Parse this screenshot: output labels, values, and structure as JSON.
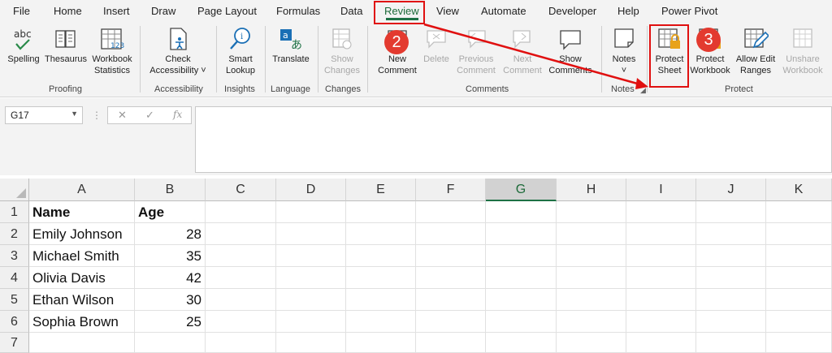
{
  "menu": {
    "tabs": [
      "File",
      "Home",
      "Insert",
      "Draw",
      "Page Layout",
      "Formulas",
      "Data",
      "Review",
      "View",
      "Automate",
      "Developer",
      "Help",
      "Power Pivot"
    ],
    "active_tab": "Review"
  },
  "ribbon": {
    "groups": [
      {
        "label": "Proofing",
        "buttons": [
          {
            "line1": "Spelling",
            "line2": "",
            "icon": "spelling-icon"
          },
          {
            "line1": "Thesaurus",
            "line2": "",
            "icon": "thesaurus-icon"
          },
          {
            "line1": "Workbook",
            "line2": "Statistics",
            "icon": "workbook-statistics-icon"
          }
        ]
      },
      {
        "label": "Accessibility",
        "buttons": [
          {
            "line1": "Check",
            "line2": "Accessibility ˅",
            "icon": "check-accessibility-icon"
          }
        ]
      },
      {
        "label": "Insights",
        "buttons": [
          {
            "line1": "Smart",
            "line2": "Lookup",
            "icon": "smart-lookup-icon"
          }
        ]
      },
      {
        "label": "Language",
        "buttons": [
          {
            "line1": "Translate",
            "line2": "",
            "icon": "translate-icon"
          }
        ]
      },
      {
        "label": "Changes",
        "buttons": [
          {
            "line1": "Show",
            "line2": "Changes",
            "icon": "show-changes-icon",
            "disabled": true
          }
        ]
      },
      {
        "label": "Comments",
        "buttons": [
          {
            "line1": "New",
            "line2": "Comment",
            "icon": "new-comment-icon"
          },
          {
            "line1": "Delete",
            "line2": "",
            "icon": "delete-comment-icon",
            "disabled": true
          },
          {
            "line1": "Previous",
            "line2": "Comment",
            "icon": "previous-comment-icon",
            "disabled": true
          },
          {
            "line1": "Next",
            "line2": "Comment",
            "icon": "next-comment-icon",
            "disabled": true
          },
          {
            "line1": "Show",
            "line2": "Comments",
            "icon": "show-comments-icon"
          }
        ]
      },
      {
        "label": "Notes",
        "buttons": [
          {
            "line1": "Notes",
            "line2": "˅",
            "icon": "notes-icon"
          }
        ]
      },
      {
        "label": "Protect",
        "buttons": [
          {
            "line1": "Protect",
            "line2": "Sheet",
            "icon": "protect-sheet-icon"
          },
          {
            "line1": "Protect",
            "line2": "Workbook",
            "icon": "protect-workbook-icon"
          },
          {
            "line1": "Allow Edit",
            "line2": "Ranges",
            "icon": "allow-edit-ranges-icon"
          },
          {
            "line1": "Unshare",
            "line2": "Workbook",
            "icon": "unshare-workbook-icon",
            "disabled": true
          }
        ]
      }
    ]
  },
  "formula_bar": {
    "name_box": "G17",
    "cancel_symbol": "✕",
    "enter_symbol": "✓",
    "fx_symbol": "fx",
    "formula": ""
  },
  "sheet": {
    "columns": [
      "A",
      "B",
      "C",
      "D",
      "E",
      "F",
      "G",
      "H",
      "I",
      "J",
      "K"
    ],
    "selected_column": "G",
    "rows": [
      "1",
      "2",
      "3",
      "4",
      "5",
      "6",
      "7"
    ],
    "cells": [
      [
        "Name",
        "Age"
      ],
      [
        "Emily Johnson",
        "28"
      ],
      [
        "Michael Smith",
        "35"
      ],
      [
        "Olivia Davis",
        "42"
      ],
      [
        "Ethan Wilson",
        "30"
      ],
      [
        "Sophia Brown",
        "25"
      ],
      [
        "",
        ""
      ]
    ]
  },
  "annotations": {
    "step2": "2",
    "step3": "3",
    "color": "#e01010"
  },
  "colors": {
    "excel_green": "#1e7145",
    "ribbon_bg": "#f3f3f3",
    "badge_red": "#e33a2f"
  }
}
